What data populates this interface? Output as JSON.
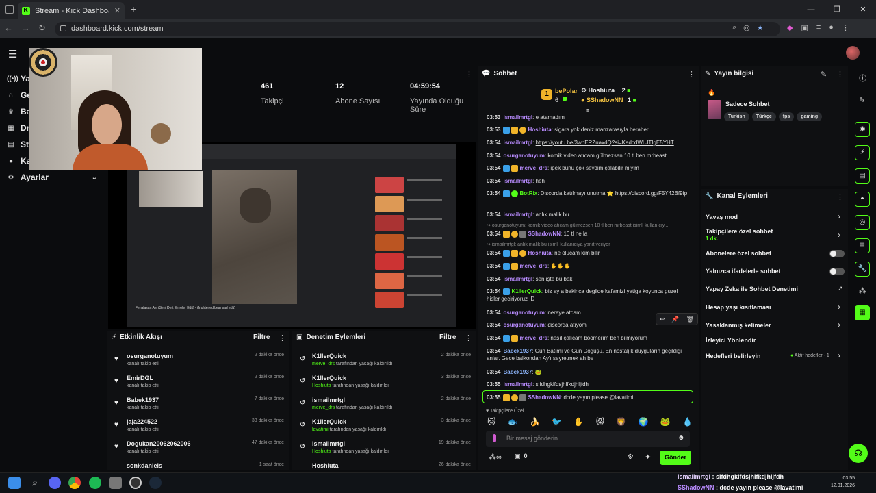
{
  "browser": {
    "tab_title": "Stream - Kick Dashboard",
    "url": "dashboard.kick.com/stream"
  },
  "sidebar": {
    "items": [
      {
        "label": "Ya",
        "icon": "broadcast-icon"
      },
      {
        "label": "Ge",
        "icon": "home-icon"
      },
      {
        "label": "Ba",
        "icon": "trophy-icon"
      },
      {
        "label": "Dr",
        "icon": "grid-icon"
      },
      {
        "label": "St",
        "icon": "layers-icon"
      },
      {
        "label": "Ka",
        "icon": "person-icon"
      },
      {
        "label": "Ayarlar",
        "icon": "gear-icon"
      }
    ]
  },
  "stats": [
    {
      "value": "",
      "label": "ci"
    },
    {
      "value": "461",
      "label": "Takipçi"
    },
    {
      "value": "12",
      "label": "Abone Sayısı"
    },
    {
      "value": "04:59:54",
      "label": "Yayında Olduğu Süre"
    }
  ],
  "preview": {
    "caption": "Fenalaşan Ayı (Seni Dert Elmeler Edit) - (frightened bear sad edit)"
  },
  "activity": {
    "title": "Etkinlik Akışı",
    "filter": "Filtre",
    "items": [
      {
        "name": "osurganotuyum",
        "sub": "kanalı takip etti",
        "time": "2 dakika önce"
      },
      {
        "name": "EmirDGL",
        "sub": "kanalı takip etti",
        "time": "2 dakika önce"
      },
      {
        "name": "Babek1937",
        "sub": "kanalı takip etti",
        "time": "7 dakika önce"
      },
      {
        "name": "jaja224522",
        "sub": "kanalı takip etti",
        "time": "33 dakika önce"
      },
      {
        "name": "Dogukan20062062006",
        "sub": "kanalı takip etti",
        "time": "47 dakika önce"
      },
      {
        "name": "sonkdaniels",
        "sub": "",
        "time": "1 saat önce"
      }
    ]
  },
  "moderation": {
    "title": "Denetim Eylemleri",
    "filter": "Filtre",
    "items": [
      {
        "name": "K1llerQuick",
        "actor": "merve_drs",
        "sub": " tarafından yasağı kaldırıldı",
        "time": "2 dakika önce"
      },
      {
        "name": "K1llerQuick",
        "actor": "Hoshiuta",
        "sub": " tarafından yasağı kaldırıldı",
        "time": "3 dakika önce"
      },
      {
        "name": "ismailmrtgl",
        "actor": "merve_drs",
        "sub": " tarafından yasağı kaldırıldı",
        "time": "2 dakika önce"
      },
      {
        "name": "K1llerQuick",
        "actor": "lavatimi",
        "sub": " tarafından yasağı kaldırıldı",
        "time": "3 dakika önce"
      },
      {
        "name": "ismailmrtgl",
        "actor": "Hoshiuta",
        "sub": " tarafından yasağı kaldırıldı",
        "time": "19 dakika önce"
      },
      {
        "name": "Hoshiuta",
        "actor": "",
        "sub": "",
        "time": "26 dakika önce"
      }
    ]
  },
  "chat": {
    "title": "Sohbet",
    "leaderboard": [
      {
        "name": "bePolar",
        "count": "6"
      },
      {
        "name": "Hoshiuta",
        "count": "2"
      },
      {
        "name": "SShadowNN",
        "count": "1"
      }
    ],
    "messages": [
      {
        "time": "03:53",
        "user": "ismailmrtgl",
        "color": "#b98cff",
        "text": "e atamadım"
      },
      {
        "time": "03:53",
        "user": "Hoshiuta",
        "color": "#b98cff",
        "text": "sigara yok deniz manzarasıyla beraber"
      },
      {
        "time": "03:54",
        "user": "ismailmrtgl",
        "color": "#b98cff",
        "text": "https://youtu.be/3whERZuaxdQ?si=KadcdWLJTIgE5YHT"
      },
      {
        "time": "03:54",
        "user": "osurganotuyum",
        "color": "#b98cff",
        "text": "komik video atıcam gülmezsen 10 tl ben mrbeast"
      },
      {
        "time": "03:54",
        "user": "merve_drs",
        "color": "#b98cff",
        "text": "ipek  bunu çok sevdim çalabilir miyim"
      },
      {
        "time": "03:54",
        "user": "ismailmrtgl",
        "color": "#b98cff",
        "text": "heh"
      },
      {
        "time": "03:54",
        "user": "BotRix",
        "color": "#53fc18",
        "text": "Discorda katılmayı unutma!⭐ https://discord.gg/F5Y42Bf9fp"
      },
      {
        "time": "03:54",
        "user": "ismailmrtgl",
        "color": "#b98cff",
        "text": "anlık malik bu"
      },
      {
        "time": "03:54",
        "user": "SShadowNN",
        "color": "#b98cff",
        "text": "10 tl ne la"
      },
      {
        "time": "03:54",
        "user": "Hoshiuta",
        "color": "#b98cff",
        "text": "ne olucam kim bilir"
      },
      {
        "time": "03:54",
        "user": "merve_drs",
        "color": "#b98cff",
        "text": ""
      },
      {
        "time": "03:54",
        "user": "ismailmrtgl",
        "color": "#b98cff",
        "text": "sen işte bu bak"
      },
      {
        "time": "03:54",
        "user": "K1llerQuick",
        "color": "#53fc18",
        "text": "biz ay a bakinca degilde kafamizi yatiga koyunca guzel hisler geciriyoruz :D"
      },
      {
        "time": "03:54",
        "user": "osurganotuyum",
        "color": "#b98cff",
        "text": "nereye atcam"
      },
      {
        "time": "03:54",
        "user": "osurganotuyum",
        "color": "#b98cff",
        "text": "discorda atıyom"
      },
      {
        "time": "03:54",
        "user": "merve_drs",
        "color": "#b98cff",
        "text": "nasıl çalıcam boomerım ben bilmiyorum"
      },
      {
        "time": "03:54",
        "user": "Babek1937",
        "color": "#8fb8ff",
        "text": "Gün Batımı ve Gün Doğuşu. En nostaljik duyguların geçildiği anlar. Gece balkondan Ay'ı seyretmek ah be"
      },
      {
        "time": "03:54",
        "user": "Babek1937",
        "color": "#8fb8ff",
        "text": ""
      },
      {
        "time": "03:55",
        "user": "ismailmrtgl",
        "color": "#b98cff",
        "text": "slfdhgklfdsjhlfkdjhljfdh"
      },
      {
        "time": "03:55",
        "user": "SShadowNN",
        "color": "#b98cff",
        "text": "dcde yayın please @lavatimi"
      }
    ],
    "reply1": "osurganotuyum: komik video atıcam gülmezsen 10 tl ben mrbeast isimli kullanıcıy...",
    "reply2": "ismailmrtgl: anlık malik bu isimli kullanıcıya yanıt veriyor",
    "emote_label": "Takipçilere Özel",
    "input_placeholder": "Bir mesaj gönderin",
    "points": "0",
    "send": "Gönder"
  },
  "info": {
    "title": "Yayın bilgisi",
    "stream_title": "Sadece Sohbet",
    "tags": [
      "Turkish",
      "Türkçe",
      "fps",
      "gaming"
    ]
  },
  "actions": {
    "title": "Kanal Eylemleri",
    "items": [
      {
        "label": "Yavaş mod",
        "control": "chevron"
      },
      {
        "label": "Takipçilere özel sohbet",
        "sub": "1 dk.",
        "control": "chevron"
      },
      {
        "label": "Abonelere özel sohbet",
        "control": "toggle"
      },
      {
        "label": "Yalnızca ifadelerle sohbet",
        "control": "toggle"
      },
      {
        "label": "Yapay Zeka ile Sohbet Denetimi",
        "control": "external"
      },
      {
        "label": "Hesap yaşı kısıtlaması",
        "control": "chevron"
      },
      {
        "label": "Yasaklanmış kelimeler",
        "control": "chevron"
      },
      {
        "label": "İzleyici Yönlendir",
        "control": "none"
      },
      {
        "label": "Hedefleri belirleyin",
        "extra": "Aktif hedefler - 1",
        "control": "chevron"
      }
    ]
  },
  "ticker": {
    "line1_user": "ismailmrtgl",
    "line1_text": " : slfdhgklfdsjhlfkdjhljfdh",
    "line2_user": "SShadowNN",
    "line2_text": " : dcde yayın please @lavatimi"
  },
  "clock": {
    "time": "03:55",
    "date": "12.01.2026"
  },
  "colors": {
    "accent": "#53fc18",
    "purple": "#b98cff"
  }
}
